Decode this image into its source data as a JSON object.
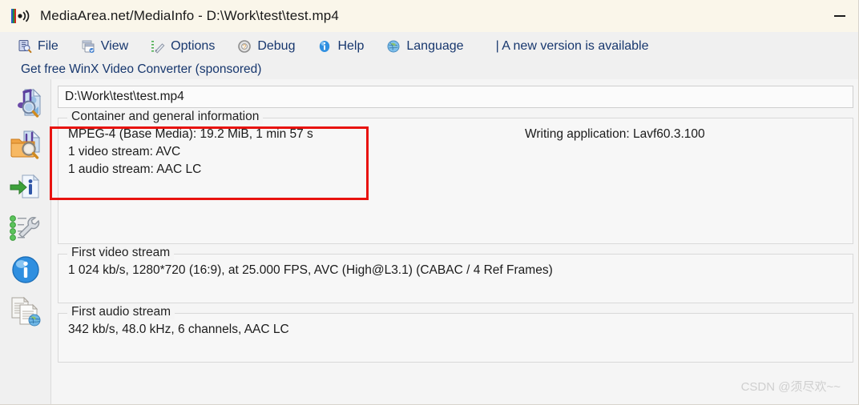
{
  "window": {
    "title": "MediaArea.net/MediaInfo - D:\\Work\\test\\test.mp4",
    "app_icon": "mediainfo-waveform-icon",
    "minimize_label": "—",
    "titlebar_color": "#faf6ea"
  },
  "menubar": {
    "items": [
      {
        "label": "File",
        "icon": "file-search-icon"
      },
      {
        "label": "View",
        "icon": "view-window-icon"
      },
      {
        "label": "Options",
        "icon": "options-pencil-icon"
      },
      {
        "label": "Debug",
        "icon": "debug-gear-icon"
      },
      {
        "label": "Help",
        "icon": "help-info-icon"
      },
      {
        "label": "Language",
        "icon": "globe-icon"
      }
    ],
    "notice": "| A new version is available",
    "notice_color": "#17376e"
  },
  "sponsored": {
    "text": "Get free WinX Video Converter (sponsored)"
  },
  "sidebar": {
    "items": [
      {
        "name": "open-file-button",
        "icon": "music-file-magnifier-icon"
      },
      {
        "name": "open-folder-button",
        "icon": "folder-magnifier-icon"
      },
      {
        "name": "export-info-button",
        "icon": "green-arrow-info-icon"
      },
      {
        "name": "tree-options-button",
        "icon": "wrench-checklist-icon"
      },
      {
        "name": "about-button",
        "icon": "blue-info-circle-icon"
      },
      {
        "name": "export-html-button",
        "icon": "documents-globe-icon"
      }
    ]
  },
  "path_field": {
    "value": "D:\\Work\\test\\test.mp4",
    "placeholder": "D:\\Work\\test\\test.mp4"
  },
  "groups": {
    "container": {
      "legend": "Container and general information",
      "lines": [
        "MPEG-4 (Base Media): 19.2 MiB, 1 min 57 s",
        "1 video stream: AVC",
        "1 audio stream: AAC LC"
      ],
      "right_lines": [
        "Writing application: Lavf60.3.100"
      ]
    },
    "video": {
      "legend": "First video stream",
      "lines": [
        "1 024 kb/s, 1280*720 (16:9), at 25.000 FPS, AVC (High@L3.1) (CABAC / 4 Ref Frames)"
      ]
    },
    "audio": {
      "legend": "First audio stream",
      "lines": [
        "342 kb/s, 48.0 kHz, 6 channels, AAC LC"
      ]
    }
  },
  "annotation": {
    "red_box_color": "#e8130f",
    "highlights": [
      "MPEG-4 (Base Media): 19.2 MiB, 1 min 57 s",
      "1 video stream: AVC",
      "1 audio stream: AAC LC"
    ]
  },
  "watermark": {
    "text": "CSDN @须尽欢~~"
  }
}
